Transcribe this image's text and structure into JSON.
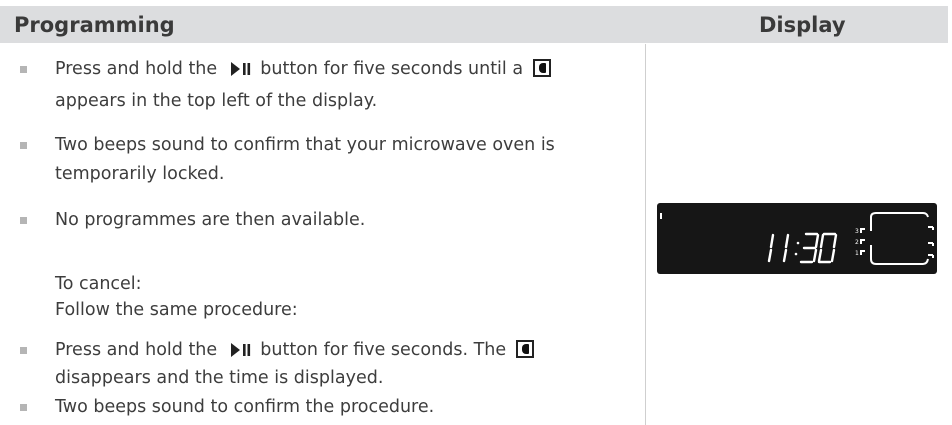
{
  "header": {
    "left": "Programming",
    "right": "Display"
  },
  "items": [
    {
      "type": "bullet",
      "parts": [
        "Press and hold the ",
        "▶II",
        " button for five seconds until a ",
        "[lock]"
      ],
      "line2": "appears in the top left  of the display."
    },
    {
      "type": "bullet",
      "line1": "Two beeps sound to confirm that your microwave oven is",
      "line2": "temporarily locked."
    },
    {
      "type": "bullet",
      "line1": "No programmes are then available."
    }
  ],
  "cancel": {
    "title": "To cancel:",
    "subtitle": "Follow the same procedure:"
  },
  "items2": [
    {
      "type": "bullet",
      "pre": "Press and hold the ",
      "post": " button for five seconds. The ",
      "line2": "disappears and the time is displayed."
    },
    {
      "type": "bullet",
      "line1": "Two beeps sound to confirm the procedure."
    }
  ],
  "display": {
    "time": "11:30",
    "levels": [
      "3",
      "2",
      "1"
    ]
  },
  "colors": {
    "header_bg": "#dcdddf",
    "bullet": "#b5b5b5",
    "display_bg": "#161616"
  },
  "icons": {
    "play_pause": "play-pause-icon",
    "lock": "lock-icon"
  }
}
